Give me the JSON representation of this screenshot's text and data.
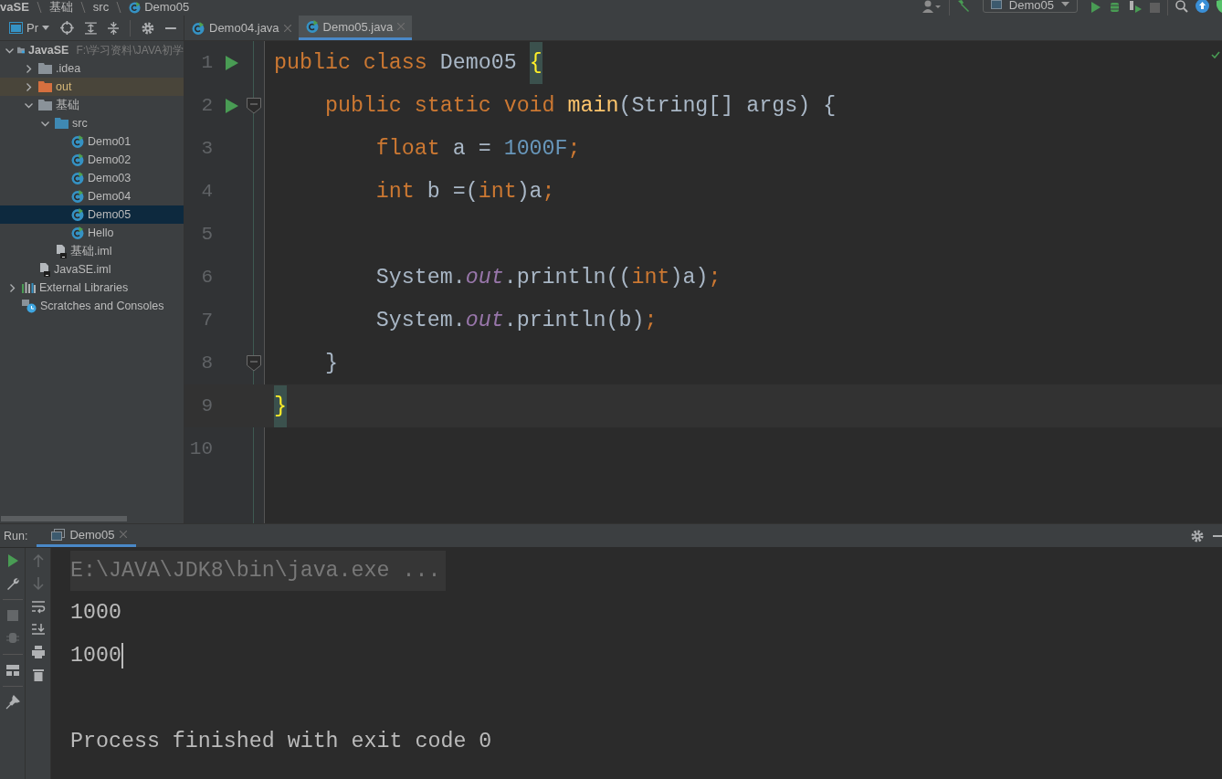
{
  "breadcrumb": [
    {
      "text": "vaSE",
      "kind": "project"
    },
    {
      "text": "基础",
      "kind": "folder"
    },
    {
      "text": "src",
      "kind": "folder"
    },
    {
      "text": "Demo05",
      "kind": "class"
    }
  ],
  "toolbar": {
    "run_config": "Demo05"
  },
  "project_panel": {
    "title": "Pr",
    "tree": [
      {
        "label": "JavaSE",
        "hint": "F:\\学习资料\\JAVA初学",
        "kind": "project",
        "expanded": true,
        "selected": false,
        "children": [
          {
            "label": ".idea",
            "kind": "folder",
            "expanded": false,
            "selected": false
          },
          {
            "label": "out",
            "kind": "excluded",
            "expanded": false,
            "selected": false
          },
          {
            "label": "基础",
            "kind": "folder",
            "expanded": true,
            "selected": false,
            "children": [
              {
                "label": "src",
                "kind": "source",
                "expanded": true,
                "selected": false,
                "children": [
                  {
                    "label": "Demo01",
                    "kind": "class",
                    "selected": false
                  },
                  {
                    "label": "Demo02",
                    "kind": "class",
                    "selected": false
                  },
                  {
                    "label": "Demo03",
                    "kind": "class",
                    "selected": false
                  },
                  {
                    "label": "Demo04",
                    "kind": "class",
                    "selected": false
                  },
                  {
                    "label": "Demo05",
                    "kind": "class",
                    "selected": true
                  },
                  {
                    "label": "Hello",
                    "kind": "class",
                    "selected": false
                  }
                ]
              },
              {
                "label": "基础.iml",
                "kind": "file",
                "selected": false
              }
            ]
          },
          {
            "label": "JavaSE.iml",
            "kind": "file",
            "selected": false
          }
        ]
      },
      {
        "label": "External Libraries",
        "kind": "libraries",
        "expanded": false,
        "selected": false
      },
      {
        "label": "Scratches and Consoles",
        "kind": "scratches",
        "selected": false
      }
    ]
  },
  "editor_tabs": [
    {
      "label": "Demo04.java",
      "selected": false
    },
    {
      "label": "Demo05.java",
      "selected": true
    }
  ],
  "code": [
    {
      "number": "1",
      "run_marker": true,
      "fold": false,
      "current": false,
      "tokens": [
        {
          "text": "public class ",
          "kind": "keyword"
        },
        {
          "text": "Demo05 ",
          "kind": "plain"
        },
        {
          "text": "{",
          "kind": "brace_match"
        }
      ]
    },
    {
      "number": "2",
      "run_marker": true,
      "fold": true,
      "current": false,
      "tokens": [
        {
          "text": "    public static void ",
          "kind": "keyword"
        },
        {
          "text": "main",
          "kind": "method"
        },
        {
          "text": "(String[] args) {",
          "kind": "plain"
        }
      ]
    },
    {
      "number": "3",
      "run_marker": false,
      "fold": false,
      "current": false,
      "tokens": [
        {
          "text": "        float ",
          "kind": "keyword"
        },
        {
          "text": "a = ",
          "kind": "plain"
        },
        {
          "text": "1000F",
          "kind": "number"
        },
        {
          "text": ";",
          "kind": "keyword"
        }
      ]
    },
    {
      "number": "4",
      "run_marker": false,
      "fold": false,
      "current": false,
      "tokens": [
        {
          "text": "        int ",
          "kind": "keyword"
        },
        {
          "text": "b =(",
          "kind": "plain"
        },
        {
          "text": "int",
          "kind": "keyword"
        },
        {
          "text": ")a",
          "kind": "plain"
        },
        {
          "text": ";",
          "kind": "keyword"
        }
      ]
    },
    {
      "number": "5",
      "run_marker": false,
      "fold": false,
      "current": false
    },
    {
      "number": "6",
      "run_marker": false,
      "fold": false,
      "current": false,
      "tokens": [
        {
          "text": "        System.",
          "kind": "plain"
        },
        {
          "text": "out",
          "kind": "static_field"
        },
        {
          "text": ".println((",
          "kind": "plain"
        },
        {
          "text": "int",
          "kind": "keyword"
        },
        {
          "text": ")a)",
          "kind": "plain"
        },
        {
          "text": ";",
          "kind": "keyword"
        }
      ]
    },
    {
      "number": "7",
      "run_marker": false,
      "fold": false,
      "current": false,
      "tokens": [
        {
          "text": "        System.",
          "kind": "plain"
        },
        {
          "text": "out",
          "kind": "static_field"
        },
        {
          "text": ".println(b)",
          "kind": "plain"
        },
        {
          "text": ";",
          "kind": "keyword"
        }
      ]
    },
    {
      "number": "8",
      "run_marker": false,
      "fold": true,
      "current": false,
      "tokens": [
        {
          "text": "    }",
          "kind": "plain"
        }
      ]
    },
    {
      "number": "9",
      "run_marker": false,
      "fold": false,
      "current": true,
      "tokens": [
        {
          "text": "}",
          "kind": "brace_match"
        }
      ]
    },
    {
      "number": "10",
      "run_marker": false,
      "fold": false,
      "current": false
    }
  ],
  "run_panel": {
    "label": "Run:",
    "tab": "Demo05",
    "tools": [
      {
        "kind": "rerun",
        "disabled": false
      },
      {
        "kind": "wrench",
        "disabled": false
      },
      {
        "kind": "stop",
        "disabled": true
      },
      {
        "kind": "bug",
        "disabled": true
      },
      {
        "kind": "layout",
        "disabled": false
      },
      {
        "kind": "pin",
        "disabled": false
      }
    ],
    "console_tools": [
      {
        "kind": "up",
        "disabled": true
      },
      {
        "kind": "down",
        "disabled": true
      },
      {
        "kind": "wrap",
        "disabled": false
      },
      {
        "kind": "scroll_end",
        "disabled": false
      },
      {
        "kind": "print",
        "disabled": false
      },
      {
        "kind": "trash",
        "disabled": false
      }
    ],
    "console": [
      {
        "text": "E:\\JAVA\\JDK8\\bin\\java.exe ...",
        "kind": "command",
        "caret": false
      },
      {
        "text": "1000",
        "kind": "output",
        "caret": false
      },
      {
        "text": "1000",
        "kind": "output",
        "caret": true
      },
      {
        "text": "Process finished with exit code 0",
        "kind": "exit",
        "caret": false
      }
    ]
  }
}
